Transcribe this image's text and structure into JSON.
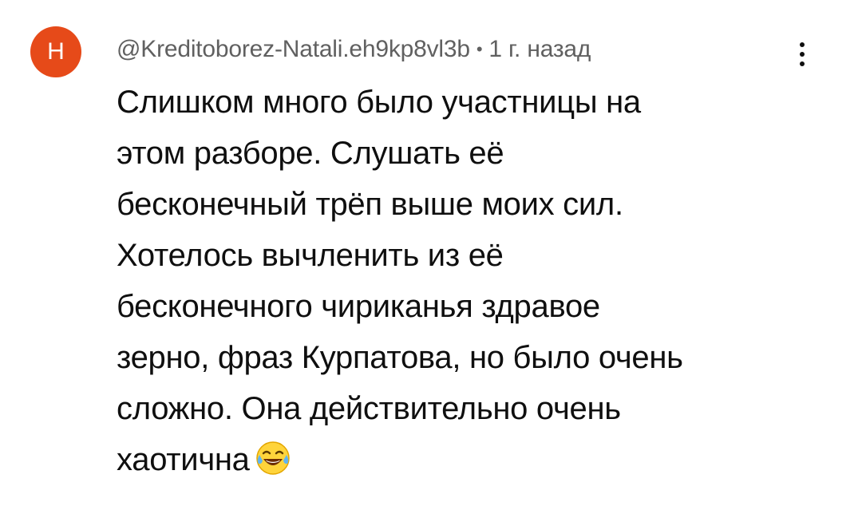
{
  "comment": {
    "avatar_letter": "Н",
    "avatar_color": "#e64a19",
    "author": "@Kreditoborez-Natali.eh9kp8vl3b",
    "separator": "•",
    "time": "1 г. назад",
    "menu_icon": "more-vertical-icon",
    "lines": [
      "Слишком много было участницы на",
      "этом разборе. Слушать её",
      "бесконечный трёп выше моих сил.",
      "Хотелось вычленить из её",
      "бесконечного чириканья здравое",
      "зерно, фраз Курпатова, но было очень",
      "сложно. Она действительно очень",
      "хаотична"
    ],
    "emoji": "face-with-tears-of-joy-icon"
  }
}
